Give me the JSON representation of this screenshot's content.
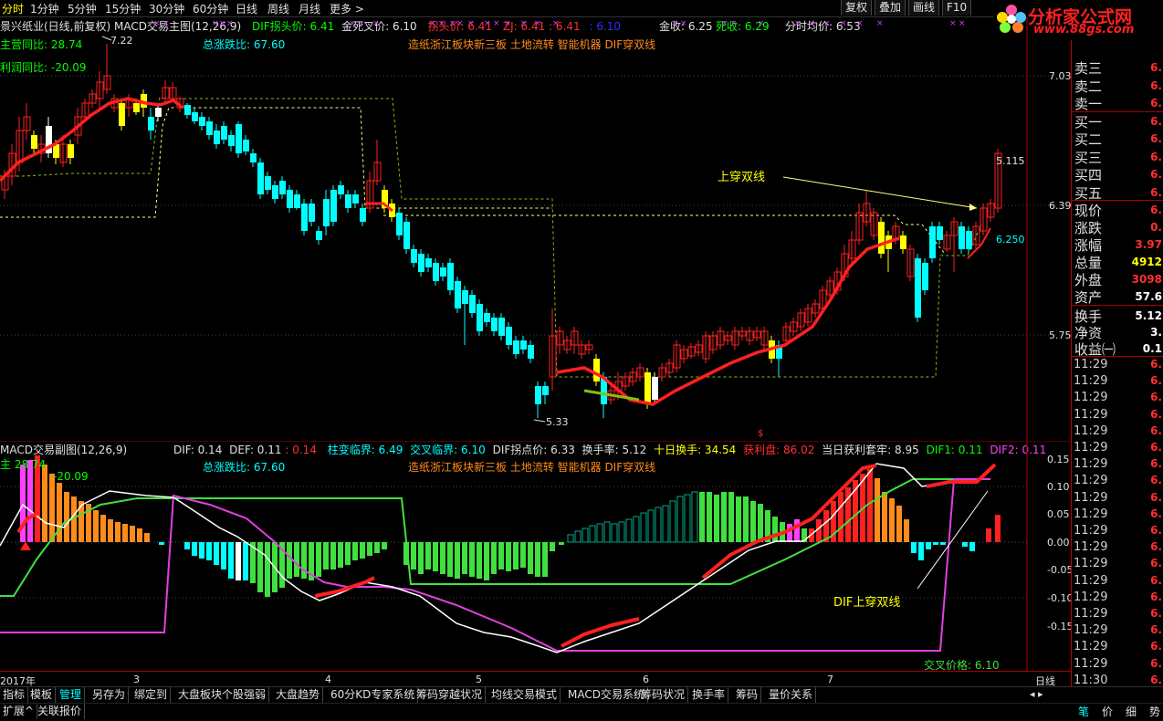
{
  "period_tabs": [
    "分时",
    "1分钟",
    "5分钟",
    "15分钟",
    "30分钟",
    "60分钟",
    "日线",
    "周线",
    "月线",
    "更多 >"
  ],
  "toolbar": {
    "restore": "复权",
    "overlay": "叠加",
    "draw": "画线",
    "f10": "F10"
  },
  "logo": {
    "name": "分析家公式网",
    "url": "www.88gs.com"
  },
  "main_chart": {
    "title": "景兴纸业(日线,前复权) MACD交易主图(12,26,9)",
    "indicators": [
      {
        "label": "DIF拐头价: 6.41",
        "color": "#00ff00"
      },
      {
        "label": "金死叉价: 6.10",
        "color": "#e0e0e0"
      },
      {
        "label": "拐头价: 6.41",
        "color": "#ff3030"
      },
      {
        "label": "ZJ: 6.41",
        "color": "#ff3030"
      },
      {
        "label": ": 6.41",
        "color": "#ff3030"
      },
      {
        "label": ": 6.10",
        "color": "#3030ff"
      },
      {
        "label": "金收: 6.25",
        "color": "#e0e0e0"
      },
      {
        "label": "死收: 6.29",
        "color": "#00ff00"
      },
      {
        "label": "分时均价: 6.53",
        "color": "#e0e0e0"
      }
    ],
    "revenue_yoy": "主营同比: 28.74",
    "profit_yoy": "利润同比: -20.09",
    "total_change": "总涨跌比: 67.60",
    "concepts": "造纸浙江板块新三板 土地流转 智能机器 DIF穿双线",
    "high_label": "7.22",
    "low_label": "5.33",
    "last_label": "5.115",
    "level_label": "6.250",
    "annotation": "上穿双线",
    "y_ticks": [
      "7.03",
      "6.39",
      "5.75"
    ]
  },
  "sub_chart": {
    "title": "MACD交易副图(12,26,9)",
    "indicators": [
      {
        "label": "DIF: 0.14",
        "color": "#e0e0e0"
      },
      {
        "label": "DEF: 0.11",
        "color": "#e0e0e0"
      },
      {
        "label": ": 0.14",
        "color": "#ff3030"
      },
      {
        "label": "柱变临界: 6.49",
        "color": "#00ffff"
      },
      {
        "label": "交叉临界: 6.10",
        "color": "#00ffff"
      },
      {
        "label": "DIF拐点价: 6.33",
        "color": "#e0e0e0"
      },
      {
        "label": "换手率: 5.12",
        "color": "#e0e0e0"
      },
      {
        "label": "十日换手: 34.54",
        "color": "#ffff00"
      },
      {
        "label": "获利盘: 86.02",
        "color": "#ff3030"
      },
      {
        "label": "当日获利套牢: 8.95",
        "color": "#e0e0e0"
      },
      {
        "label": "DIF1: 0.11",
        "color": "#00ff00"
      },
      {
        "label": "DIF2: 0.11",
        "color": "#ff40ff"
      }
    ],
    "revenue_yoy": "主 28.74",
    "profit_yoy": "-20.09",
    "total_change": "总涨跌比: 67.60",
    "concepts": "造纸浙江板块新三板 土地流转 智能机器 DIF穿双线",
    "annotation": "DIF上穿双线",
    "cross_price": "交叉价格: 6.10",
    "y_ticks": [
      "0.15",
      "0.10",
      "0.05",
      "0.00",
      "-0.05",
      "-0.10",
      "-0.15"
    ]
  },
  "x_axis": [
    "2017年",
    "3",
    "4",
    "5",
    "6",
    "7"
  ],
  "period_label": "日线",
  "right_panel": {
    "order_book": [
      {
        "label": "卖三",
        "value": "6."
      },
      {
        "label": "卖二",
        "value": "6."
      },
      {
        "label": "卖一",
        "value": "6."
      },
      {
        "label": "买一",
        "value": "6."
      },
      {
        "label": "买二",
        "value": "6."
      },
      {
        "label": "买三",
        "value": "6."
      },
      {
        "label": "买四",
        "value": "6."
      },
      {
        "label": "买五",
        "value": "6."
      }
    ],
    "quotes": [
      {
        "label": "现价",
        "value": "6."
      },
      {
        "label": "涨跌",
        "value": "0."
      },
      {
        "label": "涨幅",
        "value": "3.97"
      },
      {
        "label": "总量",
        "value": "4912"
      },
      {
        "label": "外盘",
        "value": "3098"
      },
      {
        "label": "资产",
        "value": "57.6"
      }
    ],
    "stats": [
      {
        "label": "换手",
        "value": "5.12"
      },
      {
        "label": "净资",
        "value": "3."
      },
      {
        "label": "收益㈠",
        "value": "0.1"
      }
    ],
    "ticks": [
      "11:29",
      "11:29",
      "11:29",
      "11:29",
      "11:29",
      "11:29",
      "11:29",
      "11:29",
      "11:29",
      "11:29",
      "11:29",
      "11:29",
      "11:29",
      "11:29",
      "11:29",
      "11:29",
      "11:29",
      "11:29",
      "11:29",
      "11:30"
    ],
    "tick_value": "6.",
    "bottom_tabs": [
      "笔",
      "价",
      "细",
      "势"
    ]
  },
  "bottom_tabs": [
    "指标",
    "模板",
    "管理",
    "另存为",
    "绑定到",
    "大盘板块个股强弱",
    "大盘趋势",
    "60分KD专家系统",
    "筹码穿越状况",
    "均线交易模式",
    "MACD交易系统",
    "筹码状况",
    "换手率",
    "筹码",
    "量价关系"
  ],
  "bottom_row2": [
    "扩展^",
    "关联报价"
  ],
  "colors": {
    "up": "#ff2020",
    "down": "#00ffff",
    "dif": "#ffffff",
    "green": "#00ff00",
    "magenta": "#e040e0",
    "orange": "#ff8c1a"
  }
}
